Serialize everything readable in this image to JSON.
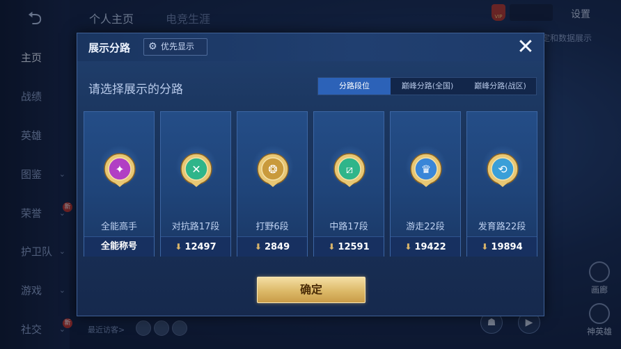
{
  "background": {
    "top_tabs": [
      "个人主页",
      "电竞生涯"
    ],
    "settings_label": "设置",
    "right_label": "定和数据展示",
    "sidebar_items": [
      {
        "label": "主页",
        "has_chevron": false,
        "is_new": false
      },
      {
        "label": "战绩",
        "has_chevron": false,
        "is_new": false
      },
      {
        "label": "英雄",
        "has_chevron": false,
        "is_new": false
      },
      {
        "label": "图鉴",
        "has_chevron": true,
        "is_new": false
      },
      {
        "label": "荣誉",
        "has_chevron": true,
        "is_new": true
      },
      {
        "label": "护卫队",
        "has_chevron": true,
        "is_new": false
      },
      {
        "label": "游戏",
        "has_chevron": true,
        "is_new": false
      },
      {
        "label": "社交",
        "has_chevron": true,
        "is_new": true
      }
    ],
    "new_badge": "新",
    "recent_visitors_label": "最近访客>",
    "right_icons": [
      "画廊",
      "神英雄"
    ],
    "vip_label": "VIP"
  },
  "modal": {
    "title": "展示分路",
    "priority_label": "优先显示",
    "subtitle": "请选择展示的分路",
    "tabs": [
      {
        "label": "分路段位",
        "active": true
      },
      {
        "label": "巅峰分路(全国)",
        "active": false
      },
      {
        "label": "巅峰分路(战区)",
        "active": false
      }
    ],
    "cards": [
      {
        "label": "全能高手",
        "bottom": "全能称号",
        "points": "",
        "icon": "all-round-badge-icon",
        "color": "#b13fc4"
      },
      {
        "label": "对抗路17段",
        "bottom": "",
        "points": "12497",
        "icon": "clash-lane-badge-icon",
        "color": "#2fb58a"
      },
      {
        "label": "打野6段",
        "bottom": "",
        "points": "2849",
        "icon": "jungle-badge-icon",
        "color": "#c99a3c"
      },
      {
        "label": "中路17段",
        "bottom": "",
        "points": "12591",
        "icon": "mid-lane-badge-icon",
        "color": "#2fb58a"
      },
      {
        "label": "游走22段",
        "bottom": "",
        "points": "19422",
        "icon": "roam-badge-icon",
        "color": "#3a86d8"
      },
      {
        "label": "发育路22段",
        "bottom": "",
        "points": "19894",
        "icon": "farm-lane-badge-icon",
        "color": "#3a9fd8"
      }
    ],
    "confirm_label": "确定"
  }
}
